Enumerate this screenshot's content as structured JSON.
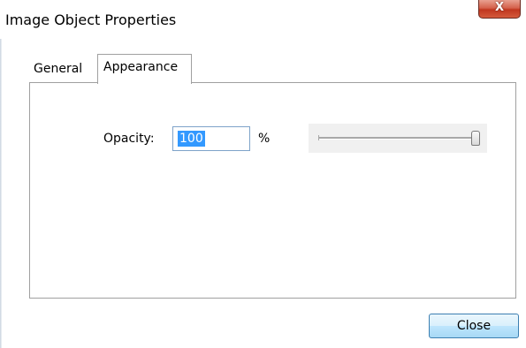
{
  "window": {
    "title": "Image Object Properties",
    "close_glyph": "X"
  },
  "tabs": [
    {
      "label": "General",
      "selected": false
    },
    {
      "label": "Appearance",
      "selected": true
    }
  ],
  "appearance": {
    "opacity_label": "Opacity:",
    "opacity_value": "100",
    "opacity_unit": "%",
    "slider_value_fraction": 1.0
  },
  "footer": {
    "close_label": "Close"
  },
  "colors": {
    "close_x_button": "#c0361f",
    "selection": "#3399ff",
    "button_border": "#3c7fb1"
  },
  "icons": {
    "close": "close-icon",
    "slider_thumb": "slider-thumb"
  }
}
